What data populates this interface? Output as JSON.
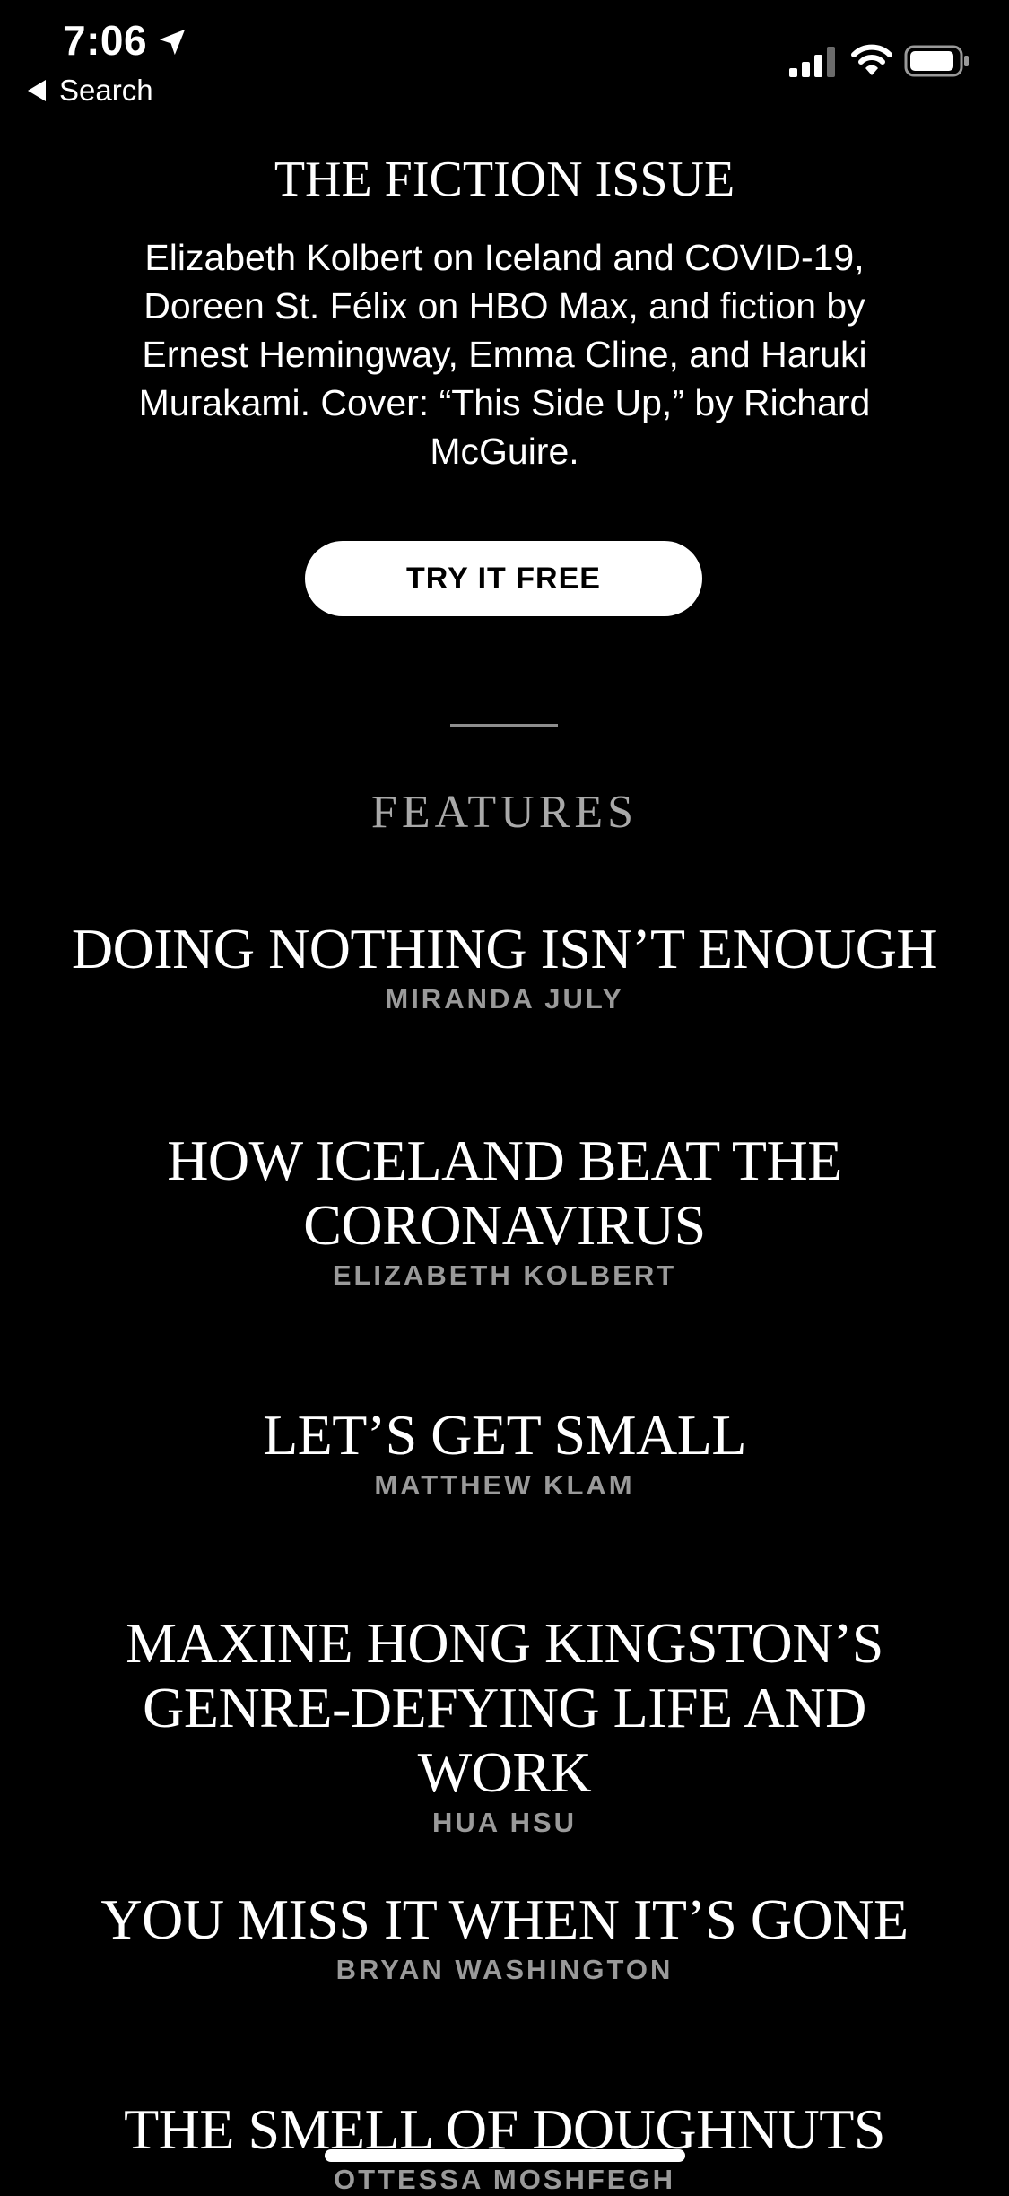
{
  "status_bar": {
    "time": "7:06",
    "back_label": "Search",
    "icons": [
      "location-arrow-icon",
      "cellular-signal-icon",
      "wifi-icon",
      "battery-icon"
    ]
  },
  "issue": {
    "title": "THE FICTION ISSUE",
    "description": "Elizabeth Kolbert on Iceland and COVID-19, Doreen St. Félix on HBO Max, and fiction by Ernest Hemingway, Emma Cline, and Haruki Murakami. Cover: “This Side Up,” by Richard McGuire.",
    "cta_label": "TRY IT FREE"
  },
  "features": {
    "heading": "FEATURES",
    "items": [
      {
        "title": "DOING NOTHING ISN’T ENOUGH",
        "author": "MIRANDA JULY"
      },
      {
        "title": "HOW ICELAND BEAT THE CORONAVIRUS",
        "author": "ELIZABETH KOLBERT"
      },
      {
        "title": "LET’S GET SMALL",
        "author": "MATTHEW KLAM"
      },
      {
        "title": "MAXINE HONG KINGSTON’S GENRE-DEFYING LIFE AND WORK",
        "author": "HUA HSU"
      },
      {
        "title": "YOU MISS IT WHEN IT’S GONE",
        "author": "BRYAN WASHINGTON"
      },
      {
        "title": "THE SMELL OF DOUGHNUTS",
        "author": "OTTESSA MOSHFEGH"
      }
    ]
  },
  "colors": {
    "background": "#000000",
    "text": "#ffffff",
    "muted": "#9a9a9a",
    "button_bg": "#ffffff"
  }
}
